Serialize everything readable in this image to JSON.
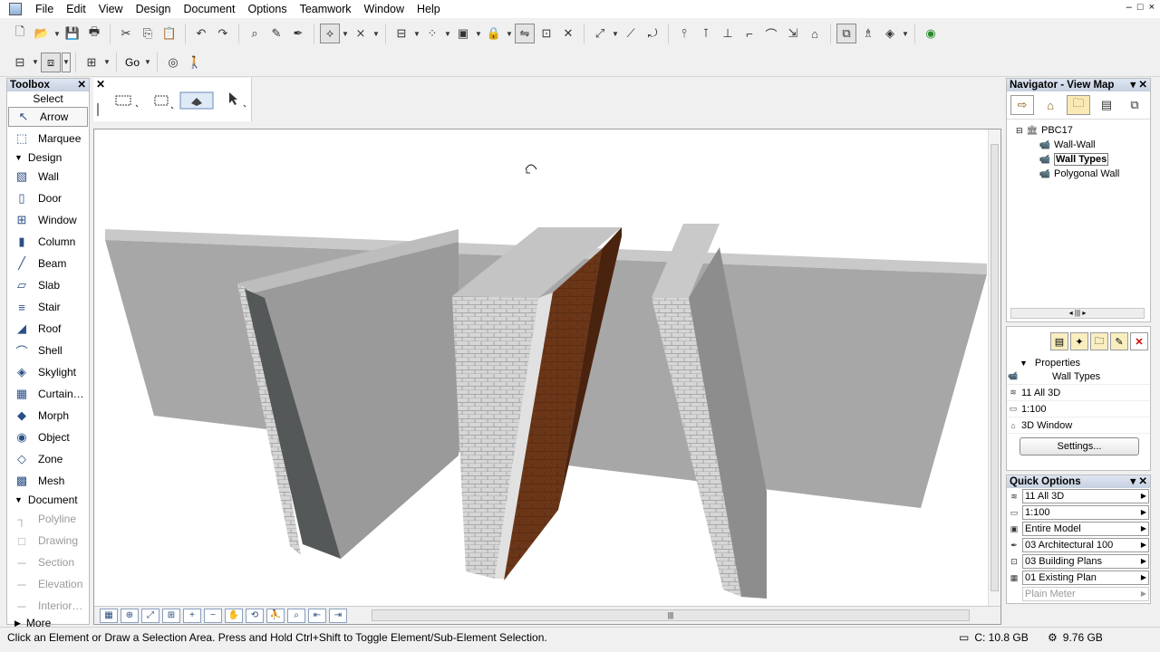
{
  "menu": [
    "File",
    "Edit",
    "View",
    "Design",
    "Document",
    "Options",
    "Teamwork",
    "Window",
    "Help"
  ],
  "window_controls": [
    "–",
    "□",
    "×"
  ],
  "toolbar2": {
    "go_label": "Go"
  },
  "toolbox": {
    "title": "Toolbox",
    "select_label": "Select",
    "tools_top": [
      {
        "label": "Arrow",
        "icon": "↖"
      },
      {
        "label": "Marquee",
        "icon": "⬚"
      }
    ],
    "design_group": "Design",
    "design_tools": [
      {
        "label": "Wall",
        "icon": "▧"
      },
      {
        "label": "Door",
        "icon": "▯"
      },
      {
        "label": "Window",
        "icon": "⊞"
      },
      {
        "label": "Column",
        "icon": "▮"
      },
      {
        "label": "Beam",
        "icon": "╱"
      },
      {
        "label": "Slab",
        "icon": "▱"
      },
      {
        "label": "Stair",
        "icon": "≡"
      },
      {
        "label": "Roof",
        "icon": "◢"
      },
      {
        "label": "Shell",
        "icon": "⌒"
      },
      {
        "label": "Skylight",
        "icon": "◈"
      },
      {
        "label": "Curtain…",
        "icon": "▦"
      },
      {
        "label": "Morph",
        "icon": "◆"
      },
      {
        "label": "Object",
        "icon": "◉"
      },
      {
        "label": "Zone",
        "icon": "◇"
      },
      {
        "label": "Mesh",
        "icon": "▩"
      }
    ],
    "document_group": "Document",
    "document_tools": [
      {
        "label": "Polyline",
        "icon": "┐"
      },
      {
        "label": "Drawing",
        "icon": "□"
      },
      {
        "label": "Section",
        "icon": "─"
      },
      {
        "label": "Elevation",
        "icon": "─"
      },
      {
        "label": "Interior…",
        "icon": "─"
      }
    ],
    "more_label": "More"
  },
  "navigator": {
    "title": "Navigator - View Map",
    "root": "PBC17",
    "items": [
      "Wall-Wall",
      "Wall Types",
      "Polygonal Wall"
    ],
    "active_item": "Wall Types"
  },
  "properties": {
    "title": "Properties",
    "name": "Wall Types",
    "rows": [
      "11 All 3D",
      "1:100",
      "3D Window"
    ],
    "settings_button": "Settings..."
  },
  "quick_options": {
    "title": "Quick Options",
    "rows": [
      "11 All 3D",
      "1:100",
      "Entire Model",
      "03 Architectural 100",
      "03 Building Plans",
      "01 Existing Plan",
      "Plain Meter"
    ]
  },
  "status": {
    "message": "Click an Element or Draw a Selection Area. Press and Hold Ctrl+Shift to Toggle Element/Sub-Element Selection.",
    "disk": "C: 10.8 GB",
    "ram": "9.76 GB"
  },
  "colors": {
    "wall_face": "#a7a7a7",
    "concrete_dark": "#555858",
    "brick_light": "#d3d3d3",
    "wood_brown": "#6b3618",
    "palette_header": "#c6d0e0"
  }
}
